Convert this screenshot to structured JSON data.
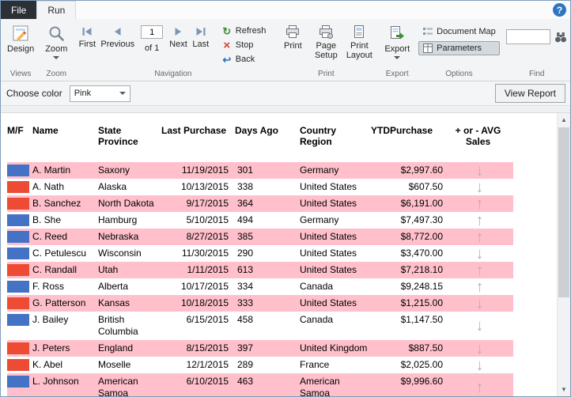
{
  "tabs": {
    "file": "File",
    "run": "Run"
  },
  "icons": {
    "help": "?",
    "refresh": "↻",
    "stop": "×",
    "back": "↩",
    "scroll_up": "▲",
    "scroll_down": "▼",
    "trend_up": "↑",
    "trend_down": "↓"
  },
  "ribbon": {
    "views": {
      "design": "Design",
      "label": "Views"
    },
    "zoom": {
      "zoom": "Zoom",
      "label": "Zoom"
    },
    "navigation": {
      "first": "First",
      "previous": "Previous",
      "page_value": "1",
      "page_of": "of 1",
      "next": "Next",
      "last": "Last",
      "refresh": "Refresh",
      "stop": "Stop",
      "back": "Back",
      "label": "Navigation"
    },
    "print": {
      "print": "Print",
      "page_setup": "Page Setup",
      "print_layout": "Print Layout",
      "label": "Print"
    },
    "export": {
      "export": "Export",
      "label": "Export"
    },
    "options": {
      "document_map": "Document Map",
      "parameters": "Parameters",
      "label": "Options"
    },
    "find": {
      "search_value": "",
      "label": "Find"
    }
  },
  "parameter_bar": {
    "choose_color_label": "Choose color",
    "selected_color": "Pink",
    "view_report": "View Report"
  },
  "report": {
    "columns": [
      {
        "label": "M/F"
      },
      {
        "label": "Name"
      },
      {
        "label": "State Province"
      },
      {
        "label": "Last Purchase"
      },
      {
        "label": "Days Ago"
      },
      {
        "label": "Country Region"
      },
      {
        "label": "YTDPurchase"
      },
      {
        "label": "+ or - AVG Sales"
      }
    ],
    "rows": [
      {
        "gender_color": "blue",
        "name": "A. Martin",
        "state_province": "Saxony",
        "last_purchase": "11/19/2015",
        "days_ago": "301",
        "country_region": "Germany",
        "ytd_purchase": "$2,997.60",
        "trend": "down",
        "highlighted": true
      },
      {
        "gender_color": "red",
        "name": "A. Nath",
        "state_province": "Alaska",
        "last_purchase": "10/13/2015",
        "days_ago": "338",
        "country_region": "United States",
        "ytd_purchase": "$607.50",
        "trend": "down",
        "highlighted": false
      },
      {
        "gender_color": "red",
        "name": "B. Sanchez",
        "state_province": "North Dakota",
        "last_purchase": "9/17/2015",
        "days_ago": "364",
        "country_region": "United States",
        "ytd_purchase": "$6,191.00",
        "trend": "up",
        "highlighted": true
      },
      {
        "gender_color": "blue",
        "name": "B. She",
        "state_province": "Hamburg",
        "last_purchase": "5/10/2015",
        "days_ago": "494",
        "country_region": "Germany",
        "ytd_purchase": "$7,497.30",
        "trend": "up",
        "highlighted": false
      },
      {
        "gender_color": "blue",
        "name": "C. Reed",
        "state_province": "Nebraska",
        "last_purchase": "8/27/2015",
        "days_ago": "385",
        "country_region": "United States",
        "ytd_purchase": "$8,772.00",
        "trend": "up",
        "highlighted": true
      },
      {
        "gender_color": "blue",
        "name": "C. Petulescu",
        "state_province": "Wisconsin",
        "last_purchase": "11/30/2015",
        "days_ago": "290",
        "country_region": "United States",
        "ytd_purchase": "$3,470.00",
        "trend": "down",
        "highlighted": false
      },
      {
        "gender_color": "red",
        "name": "C. Randall",
        "state_province": "Utah",
        "last_purchase": "1/11/2015",
        "days_ago": "613",
        "country_region": "United States",
        "ytd_purchase": "$7,218.10",
        "trend": "up",
        "highlighted": true
      },
      {
        "gender_color": "blue",
        "name": "F. Ross",
        "state_province": "Alberta",
        "last_purchase": "10/17/2015",
        "days_ago": "334",
        "country_region": "Canada",
        "ytd_purchase": "$9,248.15",
        "trend": "up",
        "highlighted": false
      },
      {
        "gender_color": "red",
        "name": "G. Patterson",
        "state_province": "Kansas",
        "last_purchase": "10/18/2015",
        "days_ago": "333",
        "country_region": "United States",
        "ytd_purchase": "$1,215.00",
        "trend": "down",
        "highlighted": true
      },
      {
        "gender_color": "blue",
        "name": "J. Bailey",
        "state_province": "British Columbia",
        "last_purchase": "6/15/2015",
        "days_ago": "458",
        "country_region": "Canada",
        "ytd_purchase": "$1,147.50",
        "trend": "down",
        "highlighted": false
      },
      {
        "gender_color": "red",
        "name": "J. Peters",
        "state_province": "England",
        "last_purchase": "8/15/2015",
        "days_ago": "397",
        "country_region": "United Kingdom",
        "ytd_purchase": "$887.50",
        "trend": "down",
        "highlighted": true
      },
      {
        "gender_color": "red",
        "name": "K. Abel",
        "state_province": "Moselle",
        "last_purchase": "12/1/2015",
        "days_ago": "289",
        "country_region": "France",
        "ytd_purchase": "$2,025.00",
        "trend": "down",
        "highlighted": false
      },
      {
        "gender_color": "blue",
        "name": "L. Johnson",
        "state_province": "American Samoa",
        "last_purchase": "6/10/2015",
        "days_ago": "463",
        "country_region": "American Samoa",
        "ytd_purchase": "$9,996.60",
        "trend": "up",
        "highlighted": true
      }
    ]
  },
  "colors": {
    "row_highlight": "#FFC0CB",
    "blue": "#4472C4",
    "red": "#EE4B35",
    "arrow": "#B3B3B3"
  }
}
